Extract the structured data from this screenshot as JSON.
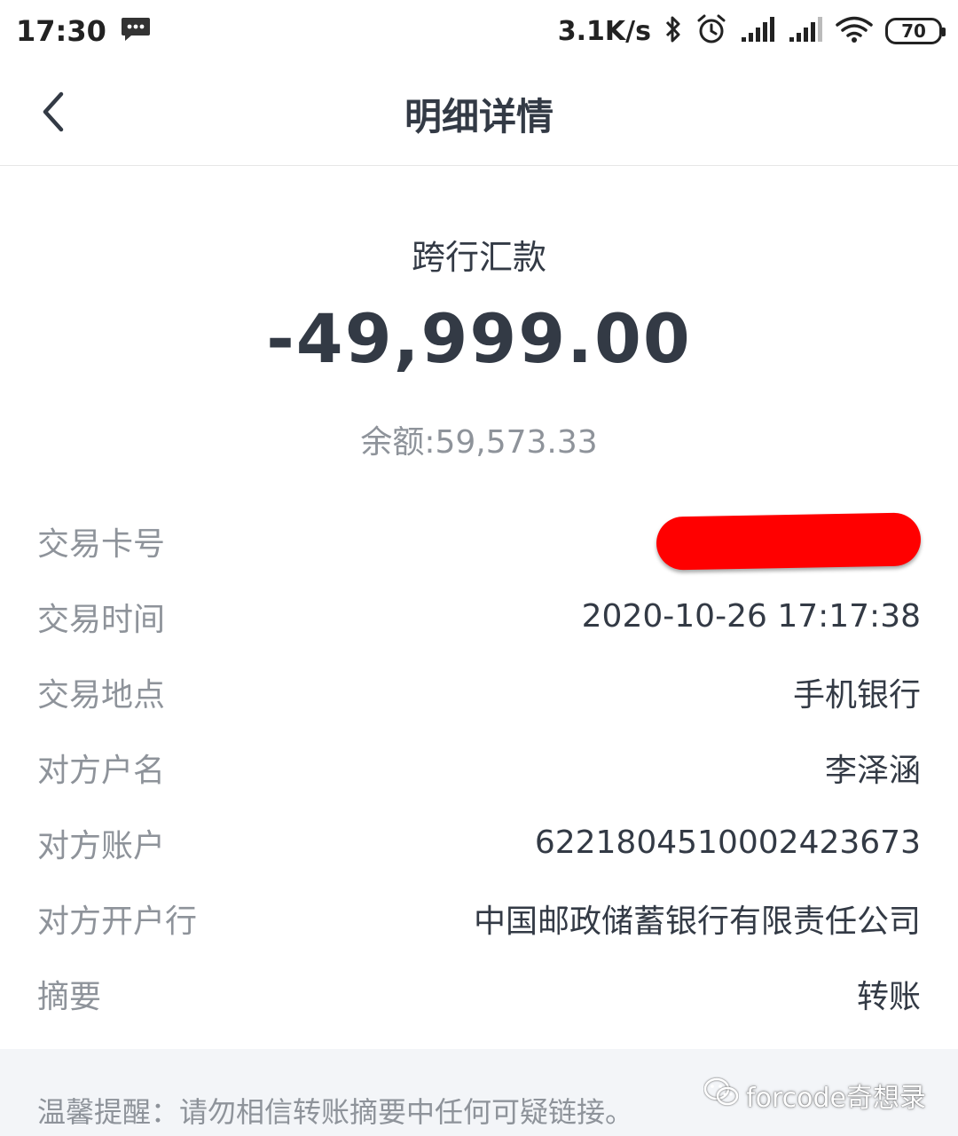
{
  "status_bar": {
    "time": "17:30",
    "message_icon": "message-icon",
    "net_speed": "3.1K/s",
    "battery": "70",
    "icons": [
      "bluetooth-icon",
      "alarm-icon",
      "signal-icon",
      "signal-icon",
      "wifi-icon"
    ]
  },
  "nav": {
    "title": "明细详情",
    "back_icon": "chevron-left-icon"
  },
  "summary": {
    "type": "跨行汇款",
    "amount": "-49,999.00",
    "balance": "余额:59,573.33"
  },
  "details": [
    {
      "label": "交易卡号",
      "value": ""
    },
    {
      "label": "交易时间",
      "value": "2020-10-26 17:17:38"
    },
    {
      "label": "交易地点",
      "value": "手机银行"
    },
    {
      "label": "对方户名",
      "value": "李泽涵"
    },
    {
      "label": "对方账户",
      "value": "6221804510002423673"
    },
    {
      "label": "对方开户行",
      "value": "中国邮政储蓄银行有限责任公司"
    },
    {
      "label": "摘要",
      "value": "转账"
    }
  ],
  "notice": {
    "text": "温馨提醒：请勿相信转账摘要中任何可疑链接。",
    "watermark": "forcode奇想录"
  },
  "colors": {
    "text_primary": "#333a45",
    "text_secondary": "#8e939a",
    "redaction": "#ff0000",
    "notice_bg": "#f3f5f8"
  }
}
